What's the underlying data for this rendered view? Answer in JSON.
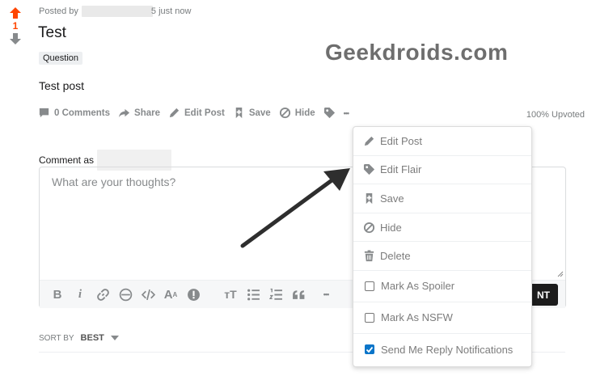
{
  "post": {
    "vote_count": "1",
    "meta_prefix": "Posted by",
    "meta_suffix": "5 just now",
    "title": "Test",
    "flair": "Question",
    "body": "Test post",
    "upvoted": "100% Upvoted"
  },
  "watermark": "Geekdroids.com",
  "actions": {
    "comments": "0 Comments",
    "share": "Share",
    "edit_post": "Edit Post",
    "save": "Save",
    "hide": "Hide",
    "more": "•••"
  },
  "comment": {
    "label": "Comment as",
    "placeholder": "What are your thoughts?",
    "button": "NT"
  },
  "toolbar": {
    "bold": "B",
    "italic": "i",
    "superscript": "A",
    "heading": "тТ",
    "more": "•••"
  },
  "sort": {
    "label": "SORT BY",
    "value": "BEST"
  },
  "menu": {
    "edit_post": "Edit Post",
    "edit_flair": "Edit Flair",
    "save": "Save",
    "hide": "Hide",
    "delete": "Delete",
    "spoiler": "Mark As Spoiler",
    "nsfw": "Mark As NSFW",
    "reply_notifications": "Send Me Reply Notifications",
    "reply_notifications_checked": true
  },
  "colors": {
    "upvote": "#ff4500",
    "icon_gray": "#878a8c",
    "checkbox_checked": "#0a75c9"
  }
}
